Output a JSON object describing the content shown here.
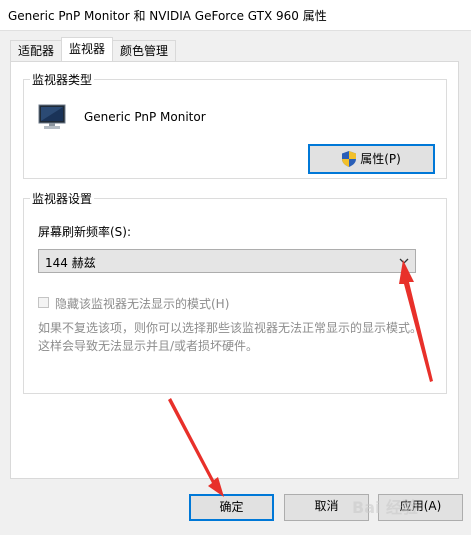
{
  "window": {
    "title": "Generic PnP Monitor 和 NVIDIA GeForce GTX 960 属性"
  },
  "tabs": [
    {
      "label": "适配器",
      "active": false
    },
    {
      "label": "监视器",
      "active": true
    },
    {
      "label": "颜色管理",
      "active": false
    }
  ],
  "monitor_type": {
    "group_label": "监视器类型",
    "monitor_name": "Generic PnP Monitor",
    "properties_button": "属性(P)"
  },
  "monitor_settings": {
    "group_label": "监视器设置",
    "refresh_rate_label": "屏幕刷新频率(S):",
    "refresh_rate_value": "144 赫兹",
    "hide_modes_label": "隐藏该监视器无法显示的模式(H)",
    "hide_modes_checked": false,
    "note_line1": "如果不复选该项，则你可以选择那些该监视器无法正常显示的显示模式。",
    "note_line2": "这样会导致无法显示并且/或者损坏硬件。"
  },
  "footer": {
    "ok": "确定",
    "cancel": "取消",
    "apply": "应用(A)"
  },
  "watermark": "Bai 经验",
  "colors": {
    "accent": "#0078d7",
    "annotation_arrow": "#e8302a"
  }
}
